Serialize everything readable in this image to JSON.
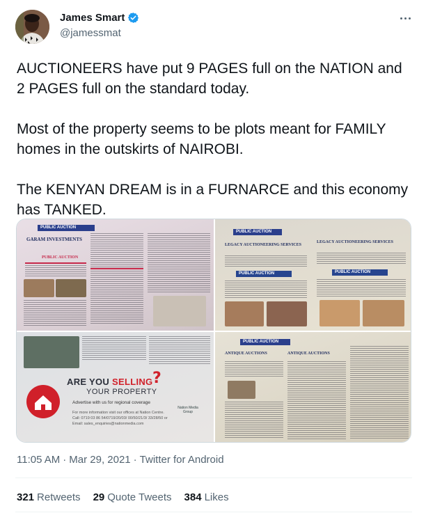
{
  "author": {
    "name": "James Smart",
    "handle": "@jamessmat",
    "verified": true
  },
  "tweet": {
    "paragraphs": [
      "AUCTIONEERS have put 9 PAGES full on the NATION and 2 PAGES full on the standard today.",
      "Most of the property seems to be plots meant for FAMILY homes in the outskirts of NAIROBI.",
      "The KENYAN DREAM is in a FURNARCE and this economy has TANKED."
    ],
    "time": "11:05 AM",
    "date": "Mar 29, 2021",
    "source": "Twitter for Android"
  },
  "media": {
    "photo1": {
      "banner": "PUBLIC AUCTION",
      "heading": "GARAM INVESTMENTS",
      "label": "PUBLIC AUCTION"
    },
    "photo2": {
      "banner": "PUBLIC AUCTION",
      "left_firm": "LEGACY AUCTIONEERING SERVICES",
      "right_firm": "LEGACY AUCTIONEERING SERVICES",
      "left_label": "PUBLIC AUCTION",
      "right_label": "PUBLIC AUCTION"
    },
    "photo3": {
      "ad_title_a": "ARE YOU ",
      "ad_title_b": "SELLING",
      "ad_subtitle": "YOUR PROPERTY",
      "ad_line": "Advertise with us for regional coverage",
      "ad_contact": "For more information visit our offices at Nation Centre. Call: 0719 03 86 54/0719/20/03/ 00/50/21/3/ 33/28/50 or Email: sales_enquiries@nationmedia.com",
      "ad_brand": "Nation Media Group"
    },
    "photo4": {
      "banner": "PUBLIC AUCTION",
      "firm_left": "ANTIQUE AUCTIONS",
      "firm_right": "ANTIQUE AUCTIONS"
    }
  },
  "stats": {
    "retweets_count": "321",
    "retweets_label": "Retweets",
    "quotes_count": "29",
    "quotes_label": "Quote Tweets",
    "likes_count": "384",
    "likes_label": "Likes"
  },
  "colors": {
    "text_primary": "#0f1419",
    "text_secondary": "#536471",
    "verified_blue": "#1d9bf0",
    "banner_blue": "#2b3f8c",
    "ad_red": "#d0202a"
  },
  "icons": [
    "verified-badge-icon",
    "more-options-icon"
  ]
}
